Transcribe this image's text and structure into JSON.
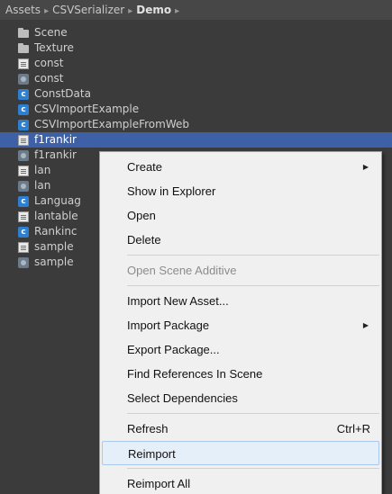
{
  "breadcrumb": {
    "items": [
      "Assets",
      "CSVSerializer",
      "Demo"
    ],
    "separator": "▸"
  },
  "files": [
    {
      "name": "Scene",
      "icon": "folder-icon"
    },
    {
      "name": "Texture",
      "icon": "folder-icon"
    },
    {
      "name": "const",
      "icon": "text-file-icon"
    },
    {
      "name": "const",
      "icon": "asset-file-icon"
    },
    {
      "name": "ConstData",
      "icon": "csharp-script-icon"
    },
    {
      "name": "CSVImportExample",
      "icon": "csharp-script-icon"
    },
    {
      "name": "CSVImportExampleFromWeb",
      "icon": "csharp-script-icon"
    },
    {
      "name": "f1rankir",
      "icon": "text-file-icon",
      "selected": true
    },
    {
      "name": "f1rankir",
      "icon": "asset-file-icon"
    },
    {
      "name": "lan",
      "icon": "text-file-icon"
    },
    {
      "name": "lan",
      "icon": "asset-file-icon"
    },
    {
      "name": "Languag",
      "icon": "csharp-script-icon"
    },
    {
      "name": "lantable",
      "icon": "text-file-icon"
    },
    {
      "name": "Rankinc",
      "icon": "csharp-script-icon"
    },
    {
      "name": "sample",
      "icon": "text-file-icon"
    },
    {
      "name": "sample",
      "icon": "asset-file-icon"
    }
  ],
  "script_icon_glyph": "c",
  "context_menu": {
    "items": [
      {
        "label": "Create",
        "submenu": true
      },
      {
        "label": "Show in Explorer"
      },
      {
        "label": "Open"
      },
      {
        "label": "Delete"
      },
      {
        "separator": true
      },
      {
        "label": "Open Scene Additive",
        "disabled": true
      },
      {
        "separator": true
      },
      {
        "label": "Import New Asset..."
      },
      {
        "label": "Import Package",
        "submenu": true
      },
      {
        "label": "Export Package..."
      },
      {
        "label": "Find References In Scene"
      },
      {
        "label": "Select Dependencies"
      },
      {
        "separator": true
      },
      {
        "label": "Refresh",
        "shortcut": "Ctrl+R"
      },
      {
        "label": "Reimport",
        "highlighted": true
      },
      {
        "separator": true
      },
      {
        "label": "Reimport All"
      }
    ],
    "submenu_arrow": "▶"
  },
  "colors": {
    "panel_bg": "#3b3b3b",
    "selection": "#3d60a7",
    "menu_bg": "#f0f0f0",
    "menu_highlight": "#e5effa"
  }
}
